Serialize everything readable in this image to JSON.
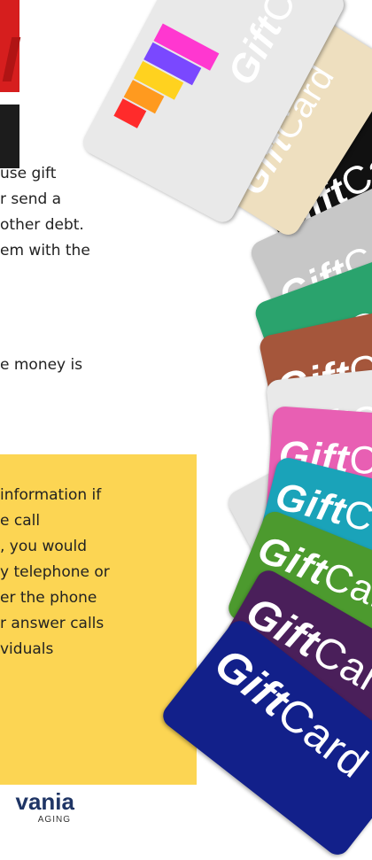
{
  "article": {
    "body_lines": [
      "use gift",
      "r send a",
      "other debt.",
      "em with the"
    ],
    "money_line": "e money is",
    "tip_lines": [
      "information if",
      "e call",
      ", you would",
      "y telephone or",
      "er the phone",
      "r answer calls",
      "viduals"
    ]
  },
  "logo": {
    "main": "vania",
    "sub": "AGING"
  },
  "cards": {
    "label_bold": "Gift",
    "label_thin": "Card",
    "colors": [
      "#e9e9e9",
      "#eedfbf",
      "#111111",
      "#c7c7c7",
      "#2aa36d",
      "#a5563b",
      "#e3e3e3",
      "#e85fb3",
      "#1aa3b9",
      "#4c9a2e",
      "#4a1f5a",
      "#12208a"
    ]
  },
  "colors": {
    "tip_background": "#fcd553",
    "logo_blue": "#1f3565",
    "corner_red": "#d61e1e"
  }
}
